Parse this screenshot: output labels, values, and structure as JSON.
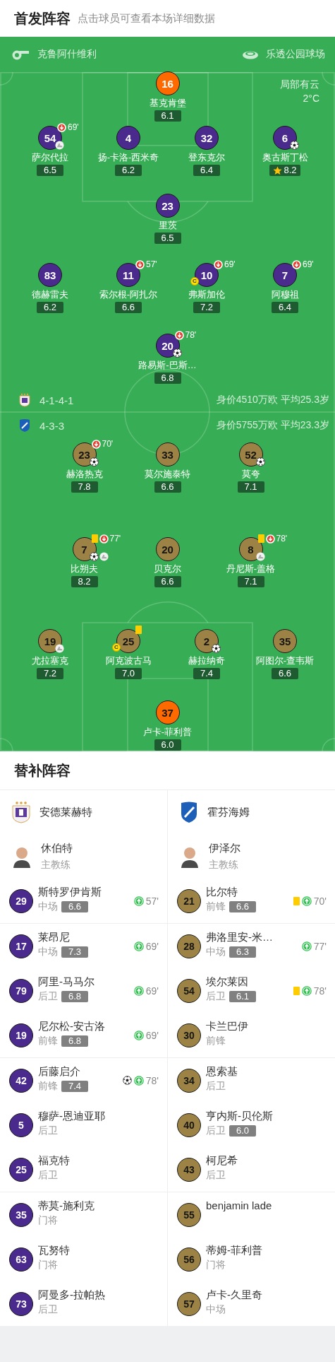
{
  "header": {
    "title": "首发阵容",
    "subtitle": "点击球员可查看本场详细数据"
  },
  "match_info": {
    "referee": "克鲁阿什维利",
    "stadium": "乐透公园球场",
    "weather": "局部有云",
    "temperature": "2°C"
  },
  "pitch": {
    "teams": [
      {
        "color": "#4a2a8c",
        "formation": "4-1-4-1",
        "value_age": "身价4510万欧 平均25.3岁",
        "lines": [
          [
            {
              "kind": "goalkeeper",
              "number": "16",
              "name": "基克肯堡",
              "rating": "6.1"
            }
          ],
          [
            {
              "kind": "outfield",
              "number": "54",
              "name": "萨尔代拉",
              "rating": "6.5",
              "sub_out": "69'",
              "assist": true
            },
            {
              "kind": "outfield",
              "number": "4",
              "name": "扬-卡洛-西米奇",
              "rating": "6.2"
            },
            {
              "kind": "outfield",
              "number": "32",
              "name": "登东克尔",
              "rating": "6.4"
            },
            {
              "kind": "outfield",
              "number": "6",
              "name": "奥古斯丁松",
              "rating": "8.2",
              "goal": true,
              "mvp": true
            }
          ],
          [
            {
              "kind": "outfield",
              "number": "23",
              "name": "里茨",
              "rating": "6.5"
            }
          ],
          [
            {
              "kind": "outfield",
              "number": "83",
              "name": "德赫雷夫",
              "rating": "6.2"
            },
            {
              "kind": "outfield",
              "number": "11",
              "name": "索尔根-阿扎尔",
              "rating": "6.6",
              "sub_out": "57'"
            },
            {
              "kind": "outfield",
              "number": "10",
              "name": "弗斯加伦",
              "rating": "7.2",
              "sub_out": "69'",
              "captain": "C"
            },
            {
              "kind": "outfield",
              "number": "7",
              "name": "阿穆祖",
              "rating": "6.4",
              "sub_out": "69'"
            }
          ],
          [
            {
              "kind": "outfield",
              "number": "20",
              "name": "路易斯-巴斯…",
              "rating": "6.8",
              "sub_out": "78'",
              "goal": true
            }
          ]
        ]
      },
      {
        "color": "#9c8345",
        "formation": "4-3-3",
        "value_age": "身价5755万欧 平均23.3岁",
        "lines": [
          [
            {
              "kind": "outfield",
              "number": "23",
              "name": "赫洛热克",
              "rating": "7.8",
              "sub_out": "70'",
              "goal": true
            },
            {
              "kind": "outfield",
              "number": "33",
              "name": "莫尔施泰特",
              "rating": "6.6"
            },
            {
              "kind": "outfield",
              "number": "52",
              "name": "莫夸",
              "rating": "7.1",
              "goal": true
            }
          ],
          [
            {
              "kind": "outfield",
              "number": "7",
              "name": "比朔夫",
              "rating": "8.2",
              "yellow": true,
              "sub_out": "77'",
              "goal": true,
              "assist": true
            },
            {
              "kind": "outfield",
              "number": "20",
              "name": "贝克尔",
              "rating": "6.6"
            },
            {
              "kind": "outfield",
              "number": "8",
              "name": "丹尼斯-盖格",
              "rating": "7.1",
              "yellow": true,
              "sub_out": "78'",
              "assist": true
            }
          ],
          [
            {
              "kind": "outfield",
              "number": "19",
              "name": "尤拉塞克",
              "rating": "7.2",
              "assist": true
            },
            {
              "kind": "outfield",
              "number": "25",
              "name": "阿克波古马",
              "rating": "7.0",
              "yellow": true,
              "captain": "C"
            },
            {
              "kind": "outfield",
              "number": "2",
              "name": "赫拉纳奇",
              "rating": "7.4",
              "goal": true
            },
            {
              "kind": "outfield",
              "number": "35",
              "name": "阿图尔-查韦斯",
              "rating": "6.6"
            }
          ],
          [
            {
              "kind": "goalkeeper",
              "number": "37",
              "name": "卢卡-菲利普",
              "rating": "6.0"
            }
          ]
        ]
      }
    ]
  },
  "bench": {
    "title": "替补阵容",
    "teams": [
      {
        "name": "安德莱赫特",
        "color": "#4a2a8c",
        "coach": {
          "name": "休伯特",
          "role": "主教练"
        },
        "groups": [
          [
            {
              "number": "29",
              "name": "斯特罗伊肯斯",
              "position": "中场",
              "rating": "6.6",
              "sub_in": "57'"
            }
          ],
          [
            {
              "number": "17",
              "name": "莱昂尼",
              "position": "中场",
              "rating": "7.3",
              "sub_in": "69'"
            },
            {
              "number": "79",
              "name": "阿里-马马尔",
              "position": "后卫",
              "rating": "6.8",
              "sub_in": "69'"
            },
            {
              "number": "19",
              "name": "尼尔松-安古洛",
              "position": "前锋",
              "rating": "6.8",
              "sub_in": "69'"
            }
          ],
          [
            {
              "number": "42",
              "name": "后藤启介",
              "position": "前锋",
              "rating": "7.4",
              "goal": true,
              "sub_in": "78'"
            },
            {
              "number": "5",
              "name": "穆萨-恩迪亚耶",
              "position": "后卫"
            },
            {
              "number": "25",
              "name": "福克特",
              "position": "后卫"
            }
          ],
          [
            {
              "number": "35",
              "name": "蒂莫-施利克",
              "position": "门将"
            },
            {
              "number": "63",
              "name": "瓦努特",
              "position": "门将"
            },
            {
              "number": "73",
              "name": "阿曼多-拉帕热",
              "position": "后卫"
            }
          ]
        ]
      },
      {
        "name": "霍芬海姆",
        "color": "#9c8345",
        "coach": {
          "name": "伊泽尔",
          "role": "主教练"
        },
        "groups": [
          [
            {
              "number": "21",
              "name": "比尔特",
              "position": "前锋",
              "rating": "6.6",
              "yellow": true,
              "sub_in": "70'"
            }
          ],
          [
            {
              "number": "28",
              "name": "弗洛里安-米…",
              "position": "中场",
              "rating": "6.3",
              "sub_in": "77'"
            },
            {
              "number": "54",
              "name": "埃尔莱因",
              "position": "后卫",
              "rating": "6.1",
              "yellow": true,
              "sub_in": "78'"
            },
            {
              "number": "30",
              "name": "卡兰巴伊",
              "position": "前锋"
            }
          ],
          [
            {
              "number": "34",
              "name": "恩索基",
              "position": "后卫"
            },
            {
              "number": "40",
              "name": "亨内斯-贝伦斯",
              "position": "后卫",
              "rating": "6.0"
            },
            {
              "number": "43",
              "name": "柯尼希",
              "position": "后卫"
            }
          ],
          [
            {
              "number": "55",
              "name": "benjamin lade"
            },
            {
              "number": "56",
              "name": "蒂姆-菲利普",
              "position": "门将"
            },
            {
              "number": "57",
              "name": "卢卡-久里奇",
              "position": "中场"
            }
          ]
        ]
      }
    ]
  }
}
